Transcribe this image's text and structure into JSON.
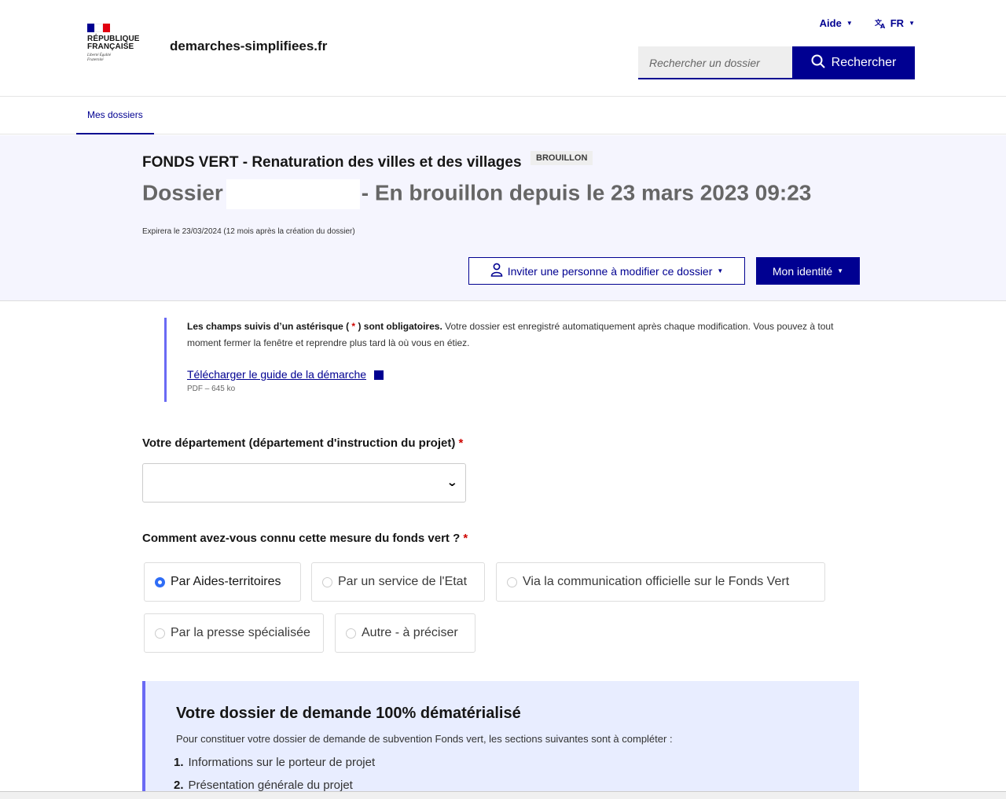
{
  "header": {
    "brand": "RÉPUBLIQUE FRANÇAISE",
    "motto": "Liberté Égalité Fraternité",
    "site_name": "demarches-simplifiees.fr",
    "help_label": "Aide",
    "lang_label": "FR",
    "search_placeholder": "Rechercher un dossier",
    "search_button": "Rechercher"
  },
  "nav": {
    "tab_label": "Mes dossiers"
  },
  "dossier": {
    "procedure_title": "FONDS VERT - Renaturation des villes et des villages",
    "status_badge": "BROUILLON",
    "dossier_word": "Dossier",
    "draft_since": "- En brouillon depuis le 23 mars 2023 09:23",
    "expiry": "Expirera le 23/03/2024 (12 mois après la création du dossier)",
    "invite_button": "Inviter une personne à modifier ce dossier",
    "identity_button": "Mon identité"
  },
  "notice": {
    "bold_prefix": "Les champs suivis d’un astérisque (",
    "asterisk": "*",
    "bold_suffix": ") sont obligatoires.",
    "text": " Votre dossier est enregistré automatiquement après chaque modification. Vous pouvez à tout moment fermer la fenêtre et reprendre plus tard là où vous en étiez.",
    "guide_link": "Télécharger le guide de la démarche",
    "guide_meta": "PDF – 645 ko"
  },
  "form": {
    "department_label": "Votre département (département d'instruction du projet)",
    "department_value": "",
    "required_mark": "*",
    "source_label": "Comment avez-vous connu cette mesure du fonds vert ?",
    "options": [
      "Par Aides-territoires",
      "Par un service de l'Etat",
      "Via la communication officielle sur le Fonds Vert",
      "Par la presse spécialisée",
      "Autre - à préciser"
    ],
    "selected_option": "Par Aides-territoires"
  },
  "info_box": {
    "title": "Votre dossier de demande 100% dématérialisé",
    "intro": "Pour constituer votre dossier de demande de subvention Fonds vert, les sections suivantes sont à compléter :",
    "items": [
      {
        "num": "1.",
        "label": "Informations sur le porteur de projet"
      },
      {
        "num": "2.",
        "label": "Présentation générale du projet"
      }
    ]
  },
  "colors": {
    "primary": "#000091",
    "accent": "#6a6af4",
    "band_bg": "#f5f5fe",
    "info_bg": "#e8edff",
    "required": "#ce0500"
  }
}
